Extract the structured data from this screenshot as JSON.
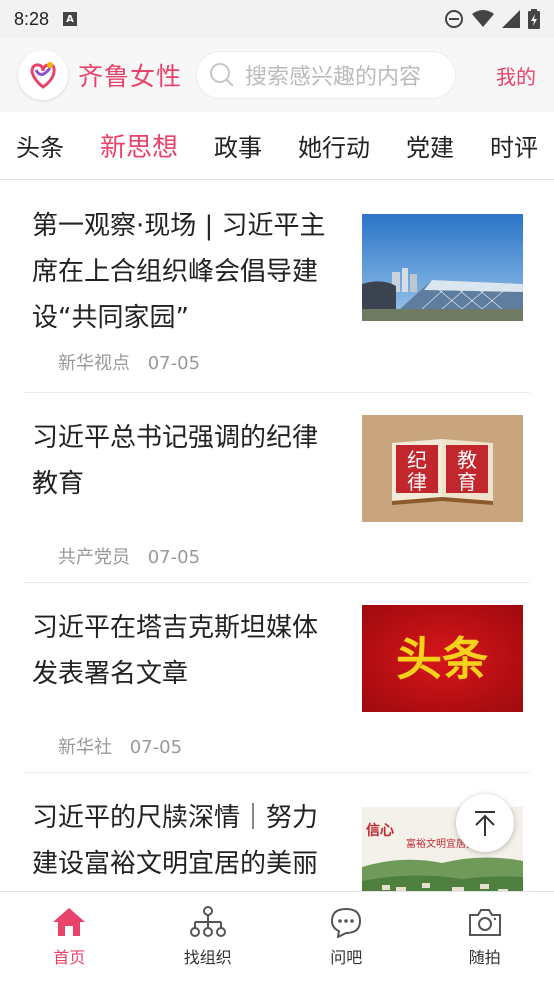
{
  "status_bar": {
    "time": "8:28",
    "icons": [
      "a-notification-icon",
      "do-not-disturb-icon",
      "wifi-icon",
      "signal-icon",
      "battery-icon"
    ]
  },
  "header": {
    "brand": "齐鲁女性",
    "search_placeholder": "搜索感兴趣的内容",
    "mine": "我的"
  },
  "tabs": [
    "头条",
    "新思想",
    "政事",
    "她行动",
    "党建",
    "时评"
  ],
  "active_tab": "新思想",
  "articles": [
    {
      "title": "第一观察·现场 | 习近平主席在上合组织峰会倡导建设“共同家园”",
      "source": "新华视点",
      "date": "07-05",
      "thumb": "conference-building-photo"
    },
    {
      "title": "习近平总书记强调的纪律教育",
      "source": "共产党员",
      "date": "07-05",
      "thumb": "discipline-education-book-image",
      "thumb_text": "纪律教育"
    },
    {
      "title": "习近平在塔吉克斯坦媒体发表署名文章",
      "source": "新华社",
      "date": "07-05",
      "thumb": "headline-banner-image",
      "thumb_text": "头条"
    },
    {
      "title": "习近平的尺牍深情｜努力建设富裕文明宜居的美丽",
      "source": "",
      "date": "",
      "thumb": "village-landscape-image",
      "thumb_text_left": "信心",
      "thumb_text_right": "富裕文明宜居美丽乡"
    }
  ],
  "bottom_nav": [
    {
      "label": "首页",
      "icon": "home-icon"
    },
    {
      "label": "找组织",
      "icon": "organization-icon"
    },
    {
      "label": "问吧",
      "icon": "chat-icon"
    },
    {
      "label": "随拍",
      "icon": "camera-icon"
    }
  ],
  "active_nav": "首页",
  "colors": {
    "accent": "#e8436a",
    "text": "#222222",
    "muted": "#999999"
  }
}
